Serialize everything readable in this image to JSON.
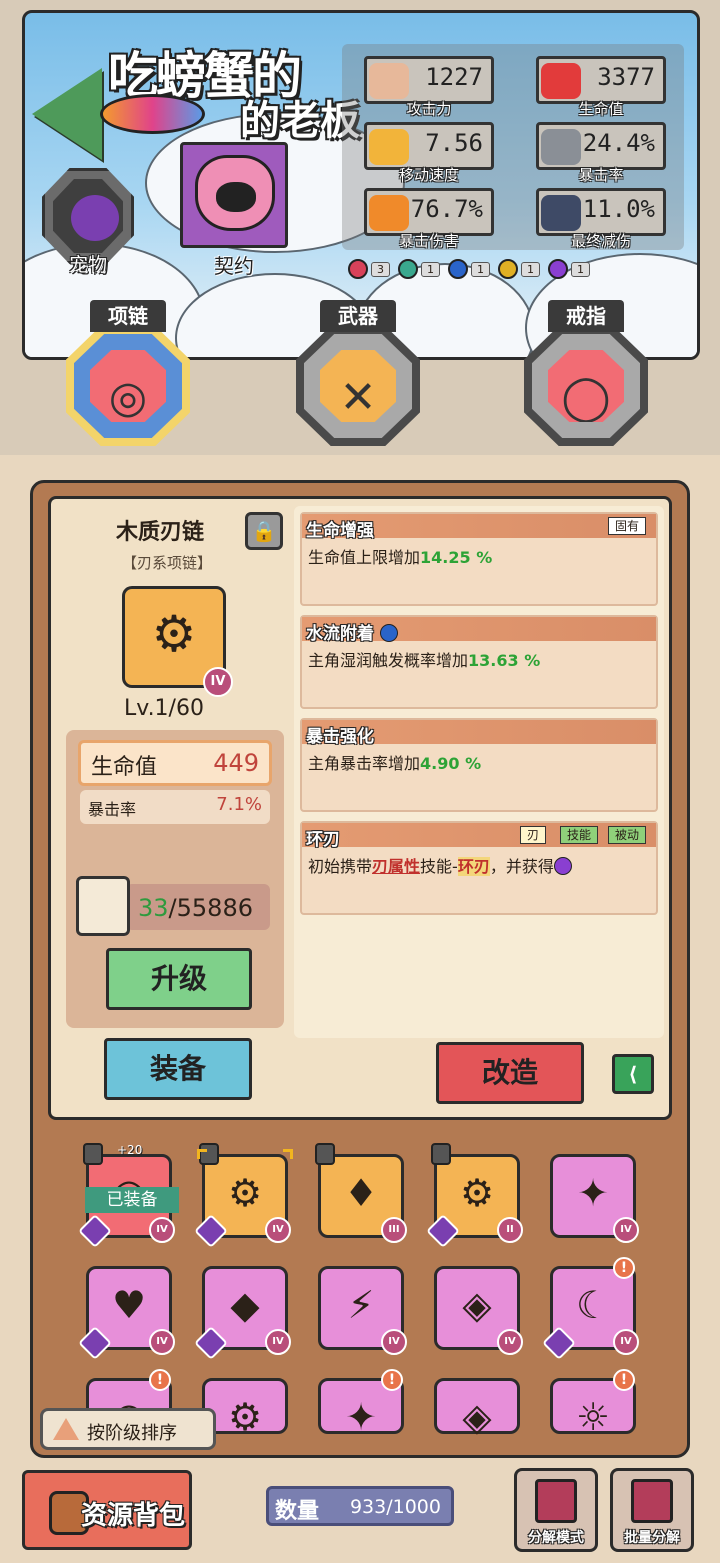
{
  "header": {
    "logo_line1": "吃螃蟹的",
    "logo_line2": "的老板",
    "pet_label": "宠物",
    "contract_label": "契约"
  },
  "stats": [
    {
      "icon": "fist-icon",
      "value": "1227",
      "label": "攻击力",
      "color": "#e7b89a"
    },
    {
      "icon": "heart-icon",
      "value": "3377",
      "label": "生命值",
      "color": "#e23b3b"
    },
    {
      "icon": "boot-icon",
      "value": "7.56",
      "label": "移动速度",
      "color": "#f2b43a"
    },
    {
      "icon": "sword-icon",
      "value": "24.4%",
      "label": "暴击率",
      "color": "#8a8f96"
    },
    {
      "icon": "explosion-icon",
      "value": "76.7%",
      "label": "暴击伤害",
      "color": "#f08a2a"
    },
    {
      "icon": "shield-icon",
      "value": "11.0%",
      "label": "最终减伤",
      "color": "#3e4a66"
    }
  ],
  "elements": [
    {
      "name": "fire",
      "count": "3",
      "color": "#d8425a"
    },
    {
      "name": "wind",
      "count": "1",
      "color": "#3aa88e"
    },
    {
      "name": "water",
      "count": "1",
      "color": "#2a64c9"
    },
    {
      "name": "thunder",
      "count": "1",
      "color": "#e0b024"
    },
    {
      "name": "arcane",
      "count": "1",
      "color": "#8a3fd1"
    }
  ],
  "slots": [
    {
      "label": "项链",
      "glyph": "◎",
      "core": "#f26c74"
    },
    {
      "label": "武器",
      "glyph": "✕",
      "core": "#f4b454"
    },
    {
      "label": "戒指",
      "glyph": "◯",
      "core": "#f26c74"
    }
  ],
  "item": {
    "name": "木质刃链",
    "type": "【刃系项链】",
    "tier": "IV",
    "level": "Lv.1/60",
    "attr_main_label": "生命值",
    "attr_main_value": "449",
    "attr_sub_label": "暴击率",
    "attr_sub_value": "7.1%",
    "mat_have": "33",
    "mat_need": "/55886",
    "upgrade_label": "升级",
    "equip_label": "装备",
    "reforge_label": "改造"
  },
  "affixes": [
    {
      "title": "生命增强",
      "tag": "固有",
      "prefix": "生命值上限增加",
      "value": "14.25 %"
    },
    {
      "title": "水流附着",
      "prefix": "主角湿润触发概率增加",
      "value": "13.63 %"
    },
    {
      "title": "暴击强化",
      "prefix": "主角暴击率增加",
      "value": "4.90 %"
    },
    {
      "title": "环刃",
      "tags": [
        "刃",
        "技能",
        "被动"
      ],
      "t1": "初始携带",
      "t2": "刃属性",
      "t3": "技能-",
      "t4": "环刃",
      "t5": "，并获得"
    }
  ],
  "inventory": {
    "plus": "+20",
    "equipped_label": "已装备",
    "cards": [
      {
        "tier": "IV",
        "glyph": "◎",
        "color": "red"
      },
      {
        "tier": "IV",
        "glyph": "⚙",
        "color": "orange"
      },
      {
        "tier": "III",
        "glyph": "♦",
        "color": "orange"
      },
      {
        "tier": "II",
        "glyph": "⚙",
        "color": "orange"
      },
      {
        "tier": "IV",
        "glyph": "✦",
        "color": "pink"
      },
      {
        "tier": "IV",
        "glyph": "♥",
        "color": "pink"
      },
      {
        "tier": "IV",
        "glyph": "◆",
        "color": "pink"
      },
      {
        "tier": "IV",
        "glyph": "⚡",
        "color": "pink"
      },
      {
        "tier": "IV",
        "glyph": "◈",
        "color": "pink"
      },
      {
        "tier": "IV",
        "glyph": "☾",
        "color": "pink"
      },
      {
        "tier": "",
        "glyph": "◎",
        "color": "pink"
      },
      {
        "tier": "",
        "glyph": "⚙",
        "color": "pink"
      },
      {
        "tier": "",
        "glyph": "✦",
        "color": "pink"
      },
      {
        "tier": "",
        "glyph": "◈",
        "color": "pink"
      },
      {
        "tier": "",
        "glyph": "☼",
        "color": "pink"
      }
    ],
    "sort_label": "按阶级排序"
  },
  "footer": {
    "resource_label": "资源背包",
    "count_label": "数量",
    "count_value": "933/1000",
    "decompose_label": "分解模式",
    "batch_label": "批量分解"
  }
}
